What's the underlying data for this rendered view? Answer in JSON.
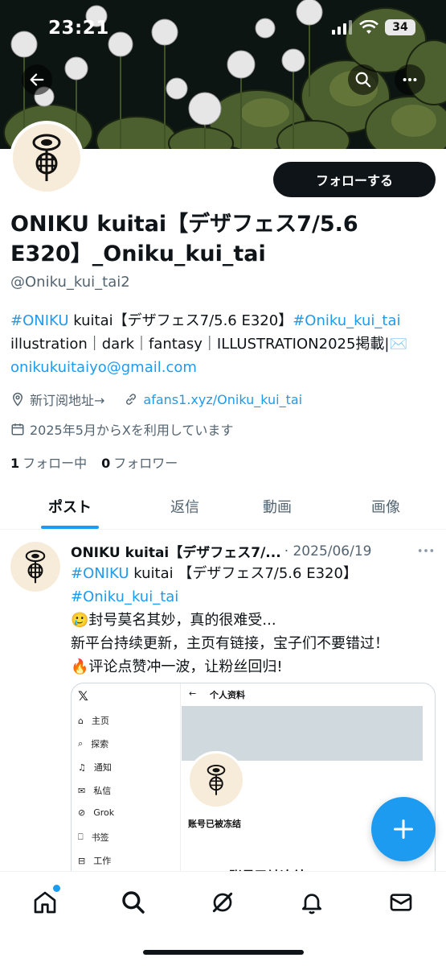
{
  "status_bar": {
    "time": "23:21",
    "battery": "34"
  },
  "profile": {
    "follow_button": "フォローする",
    "display_name": "ONIKU kuitai【デザフェス7/5.6 E320】_Oniku_kui_tai",
    "handle": "@Oniku_kui_tai2",
    "bio": {
      "hashtag1": "#ONIKU",
      "text1": " kuitai【デザフェス7/5.6 E320】",
      "hashtag2": "#Oniku_kui_tai",
      "text2": " illustration｜dark｜fantasy｜ILLUSTRATION2025掲載|",
      "email": "onikukuitaiyo@gmail.com"
    },
    "location": "新订阅地址→",
    "website": "afans1.xyz/Oniku_kui_tai",
    "joined": "2025年5月からXを利用しています",
    "following_count": "1",
    "following_label": "フォロー中",
    "followers_count": "0",
    "followers_label": "フォロワー"
  },
  "tabs": [
    "ポスト",
    "返信",
    "動画",
    "画像"
  ],
  "post": {
    "author": "ONIKU kuitai【デザフェス7/...",
    "date": "· 2025/06/19",
    "hashtag1": "#ONIKU",
    "text1": " kuitai 【デザフェス7/5.6 E320】",
    "hashtag2": "#Oniku_kui_tai",
    "line1": "🥲封号莫名其妙，真的很难受...",
    "line2": "新平台持续更新，主页有链接，宝子们不要错过！",
    "line3": "🔥评论点赞冲一波，让粉丝回归!",
    "media": {
      "logo": "𝕏",
      "menu": [
        "主页",
        "探索",
        "通知",
        "私信",
        "Grok",
        "书签",
        "工作"
      ],
      "header": "个人资料",
      "status": "账号已被冻结",
      "big_text": "账号已被冻结"
    }
  },
  "colors": {
    "accent": "#1d9bf0",
    "text": "#0f1419",
    "secondary": "#536471"
  }
}
